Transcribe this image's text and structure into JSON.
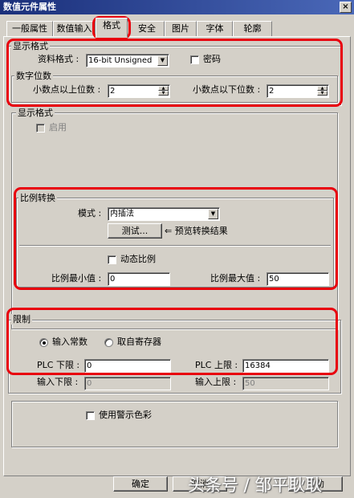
{
  "window": {
    "title": "数值元件属性",
    "close": "×"
  },
  "tabs": [
    "一般属性",
    "数值输入",
    "格式",
    "安全",
    "图片",
    "字体",
    "轮廓"
  ],
  "display_format": {
    "title": "显示格式",
    "data_format_label": "资料格式 :",
    "data_format_value": "16-bit Unsigned",
    "password_label": "密码"
  },
  "digits": {
    "title": "数字位数",
    "above_label": "小数点以上位数 :",
    "above_value": "2",
    "below_label": "小数点以下位数 :",
    "below_value": "2"
  },
  "display_format2": {
    "title": "显示格式",
    "enable_label": "启用"
  },
  "scaling": {
    "title": "比例转换",
    "mode_label": "模式 :",
    "mode_value": "内插法",
    "test_button": "测试...",
    "preview_label": "⇐ 预览转换结果",
    "dynamic_label": "动态比例",
    "min_label": "比例最小值 :",
    "min_value": "0",
    "max_label": "比例最大值 :",
    "max_value": "50"
  },
  "limits": {
    "title": "限制",
    "radio_constant": "输入常数",
    "radio_register": "取自寄存器",
    "plc_low_label": "PLC 下限 :",
    "plc_low_value": "0",
    "plc_high_label": "PLC 上限 :",
    "plc_high_value": "16384",
    "input_low_label": "输入下限 :",
    "input_low_value": "0",
    "input_high_label": "输入上限 :",
    "input_high_value": "50"
  },
  "warning_color_label": "使用警示色彩",
  "buttons": {
    "ok": "确定",
    "cancel": "取消",
    "help": "帮助"
  },
  "watermark": "头条号 / 邹平耿耿",
  "colors": {
    "highlight": "#e8000d",
    "face": "#d4d0c8",
    "titlebar": "#1a2f7a"
  }
}
